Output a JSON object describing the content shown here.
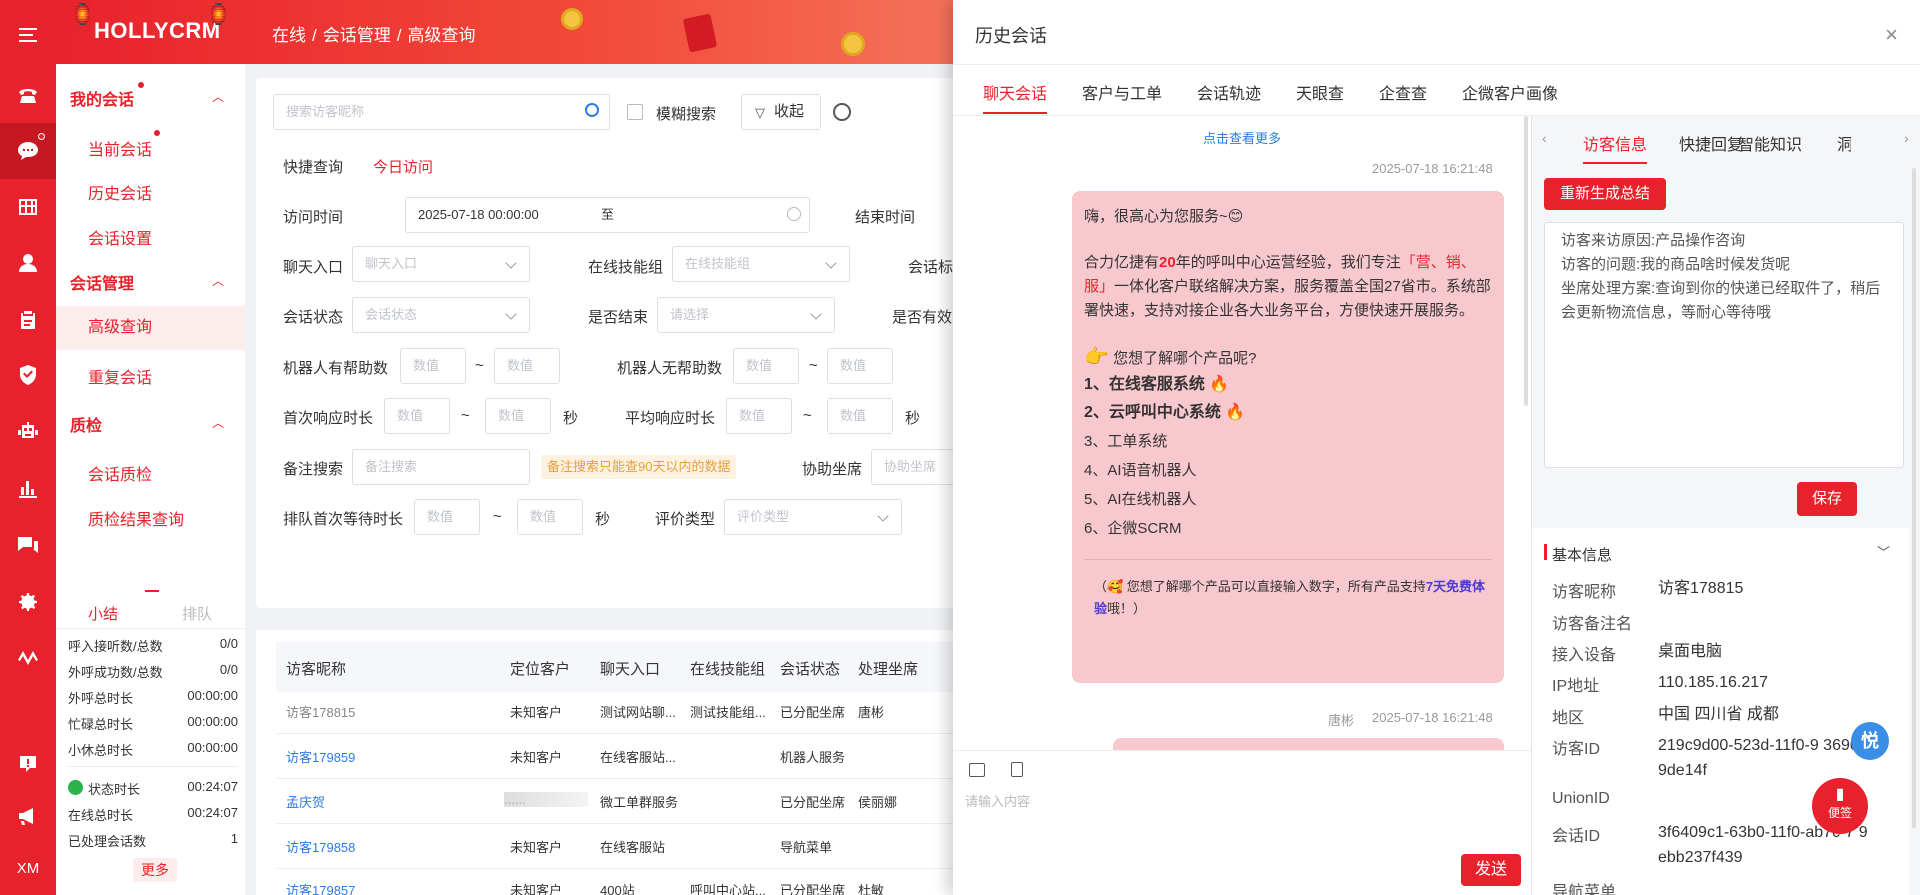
{
  "colors": {
    "brand": "#e8222c",
    "link": "#2d7be6",
    "bubble": "#f8c8cf"
  },
  "rail": {
    "icons": [
      "menu-icon",
      "phone-icon",
      "chat-icon",
      "grid-icon",
      "user-icon",
      "clipboard-icon",
      "shield-icon",
      "robot-icon",
      "bar-chart-icon",
      "messages-icon",
      "settings-icon",
      "flow-icon",
      "notice-icon",
      "megaphone-icon"
    ],
    "bottom_label": "XM"
  },
  "header": {
    "logo": "HOLLYCRM",
    "breadcrumb": [
      "在线",
      "会话管理",
      "高级查询"
    ]
  },
  "menu": {
    "groups": [
      {
        "title": "我的会话",
        "items": [
          "当前会话",
          "历史会话",
          "会话设置"
        ]
      },
      {
        "title": "会话管理",
        "items": [
          "高级查询",
          "重复会话"
        ]
      },
      {
        "title": "质检",
        "items": [
          "会话质检",
          "质检结果查询"
        ]
      }
    ],
    "mini_tabs": [
      "小结",
      "排队"
    ],
    "stats": [
      {
        "label": "呼入接听数/总数",
        "value": "0/0"
      },
      {
        "label": "外呼成功数/总数",
        "value": "0/0"
      },
      {
        "label": "外呼总时长",
        "value": "00:00:00"
      },
      {
        "label": "忙碌总时长",
        "value": "00:00:00"
      },
      {
        "label": "小休总时长",
        "value": "00:00:00"
      },
      {
        "label": "状态时长",
        "value": "00:24:07"
      },
      {
        "label": "在线总时长",
        "value": "00:24:07"
      },
      {
        "label": "已处理会话数",
        "value": "1"
      }
    ],
    "more": "更多"
  },
  "form": {
    "search_placeholder": "搜索访客昵称",
    "fuzzy": "模糊搜索",
    "collapse": "收起",
    "quick_label": "快捷查询",
    "quick_value": "今日访问",
    "visit_time": "访问时间",
    "visit_start": "2025-07-18 00:00:00",
    "to": "至",
    "end_time": "结束时间",
    "chat_entry": "聊天入口",
    "chat_entry_ph": "聊天入口",
    "skill_group": "在线技能组",
    "skill_group_ph": "在线技能组",
    "session_tag": "会话标",
    "session_status": "会话状态",
    "session_status_ph": "会话状态",
    "is_end": "是否结束",
    "is_end_ph": "请选择",
    "is_valid": "是否有效",
    "robot_help": "机器人有帮助数",
    "robot_nohelp": "机器人无帮助数",
    "num_ph": "数值",
    "tilde": "~",
    "first_resp": "首次响应时长",
    "avg_resp": "平均响应时长",
    "sec": "秒",
    "remark": "备注搜索",
    "remark_ph": "备注搜索",
    "remark_tip": "备注搜索只能查90天以内的数据",
    "assist": "协助坐席",
    "assist_ph": "协助坐席",
    "queue_wait": "排队首次等待时长",
    "rating": "评价类型",
    "rating_ph": "评价类型"
  },
  "table": {
    "headers": [
      "访客昵称",
      "定位客户",
      "聊天入口",
      "在线技能组",
      "会话状态",
      "处理坐席"
    ],
    "rows": [
      [
        "访客178815",
        "未知客户",
        "测试网站聊...",
        "测试技能组...",
        "已分配坐席",
        "唐彬"
      ],
      [
        "访客179859",
        "未知客户",
        "在线客服站...",
        "",
        "机器人服务",
        ""
      ],
      [
        "孟庆贺",
        "......",
        "微工单群服务",
        "",
        "已分配坐席",
        "侯丽娜"
      ],
      [
        "访客179858",
        "未知客户",
        "在线客服站",
        "",
        "导航菜单",
        ""
      ],
      [
        "访客179857",
        "未知客户",
        "400站",
        "呼叫中心站...",
        "已分配坐席",
        "杜敏"
      ]
    ]
  },
  "drawer": {
    "title": "历史会话",
    "close": "×",
    "tabs": [
      "聊天会话",
      "客户与工单",
      "会话轨迹",
      "天眼查",
      "企查查",
      "企微客户画像"
    ],
    "view_more": "点击查看更多",
    "msg1_time": "2025-07-18 16:21:48",
    "msg1_greeting": "嗨，很高心为您服务~😊",
    "msg1_p_pre": "合力亿捷有",
    "msg1_p_years": "20",
    "msg1_p_mid": "年的呼叫中心运营经验，我们专注",
    "msg1_p_tags": "「营、销、服」",
    "msg1_p_post": "一体化客户联络解决方案，服务覆盖全国27省市。系统部署快速，支持对接企业各大业务平台，方便快速开展服务。",
    "msg1_ask": "您想了解哪个产品呢?",
    "msg1_items": [
      "1、在线客服系统",
      "2、云呼叫中心系统",
      "3、工单系统",
      "4、AI语音机器人",
      "5、AI在线机器人",
      "6、企微SCRM"
    ],
    "msg1_tip_pre": "（🥰 您想了解哪个产品可以直接输入数字，所有产品支持",
    "msg1_tip_link": "7天免费体验",
    "msg1_tip_post": "哦！）",
    "msg2_agent": "唐彬",
    "msg2_time": "2025-07-18 16:21:48",
    "input_ph": "请输入内容",
    "send": "发送"
  },
  "rpanel": {
    "tabs": [
      "访客信息",
      "快捷回复",
      "智能知识",
      "洞"
    ],
    "regen": "重新生成总结",
    "summary": [
      "访客来访原因:产品操作咨询",
      "访客的问题:我的商品啥时候发货呢",
      "坐席处理方案:查询到你的快递已经取件了，稍后会更新物流信息，等耐心等待哦"
    ],
    "save": "保存",
    "basic_title": "基本信息",
    "fields": [
      {
        "k": "访客昵称",
        "v": "访客178815"
      },
      {
        "k": "访客备注名",
        "v": ""
      },
      {
        "k": "接入设备",
        "v": "桌面电脑"
      },
      {
        "k": "IP地址",
        "v": "110.185.16.217"
      },
      {
        "k": "地区",
        "v": "中国 四川省 成都"
      },
      {
        "k": "访客ID",
        "v": "219c9d00-523d-11f0-9 369069de14f"
      },
      {
        "k": "UnionID",
        "v": ""
      },
      {
        "k": "会话ID",
        "v": "3f6409c1-63b0-11f0-ab7c-7 9ebb237f439"
      },
      {
        "k": "导航菜单",
        "v": ""
      }
    ]
  },
  "floating": {
    "yue": "悦",
    "note": "便签"
  }
}
